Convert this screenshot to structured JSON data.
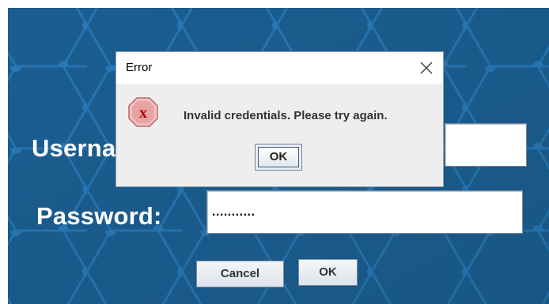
{
  "login": {
    "username_label": "Userna",
    "password_label": "Password:",
    "username_value": "",
    "password_value": "...........",
    "cancel_label": "Cancel",
    "ok_label": "OK"
  },
  "dialog": {
    "title": "Error",
    "message": "Invalid credentials. Please try again.",
    "ok_label": "OK",
    "icon": "error-x-icon",
    "close_icon": "close-icon"
  },
  "colors": {
    "background": "#1c5f92",
    "hex_lines": "#2e8ad0",
    "dialog_bg": "#eeeeee",
    "error_icon": "#d9534f"
  }
}
